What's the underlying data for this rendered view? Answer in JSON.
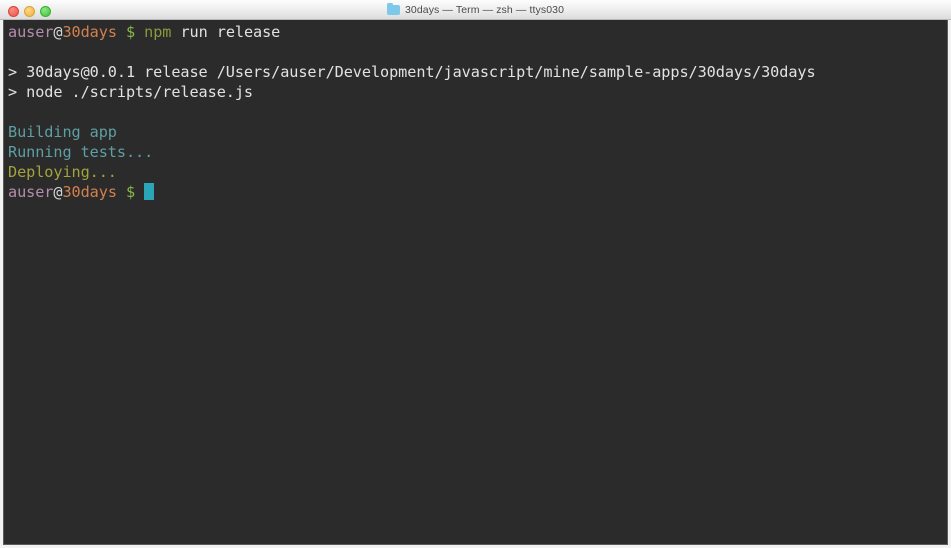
{
  "window": {
    "title": "30days — Term — zsh — ttys030",
    "folder_icon": "folder-icon",
    "controls": {
      "close": "close",
      "minimize": "minimize",
      "maximize": "maximize"
    }
  },
  "colors": {
    "terminal_background": "#2b2b2b",
    "titlebar_background": "#ededed",
    "foreground": "#e2e2e2",
    "user": "#b48ead",
    "host": "#d4804d",
    "dollar": "#86b84b",
    "command": "#8a9a3c",
    "cyan": "#5e9fa3",
    "yellow": "#a3a33c",
    "cursor": "#2ba6b8",
    "folder_icon": "#7ec9ea"
  },
  "terminal": {
    "lines": [
      {
        "id": "prompt-line-1",
        "segments": [
          {
            "text": "auser",
            "style": "c-user"
          },
          {
            "text": "@",
            "style": "c-at"
          },
          {
            "text": "30days",
            "style": "c-host"
          },
          {
            "text": " ",
            "style": "c-plain"
          },
          {
            "text": "$",
            "style": "c-dollar"
          },
          {
            "text": " ",
            "style": "c-plain"
          },
          {
            "text": "npm",
            "style": "c-cmd"
          },
          {
            "text": " run release",
            "style": "c-plain"
          }
        ]
      },
      {
        "id": "blank-1",
        "segments": []
      },
      {
        "id": "npm-header-line",
        "segments": [
          {
            "text": "> 30days@0.0.1 release /Users/auser/Development/javascript/mine/sample-apps/30days/30days",
            "style": "c-plain"
          }
        ]
      },
      {
        "id": "npm-script-line",
        "segments": [
          {
            "text": "> node ./scripts/release.js",
            "style": "c-plain"
          }
        ]
      },
      {
        "id": "blank-2",
        "segments": []
      },
      {
        "id": "output-building",
        "segments": [
          {
            "text": "Building app",
            "style": "c-cyan"
          }
        ]
      },
      {
        "id": "output-running-tests",
        "segments": [
          {
            "text": "Running tests...",
            "style": "c-cyan"
          }
        ]
      },
      {
        "id": "output-deploying",
        "segments": [
          {
            "text": "Deploying...",
            "style": "c-yellow"
          }
        ]
      },
      {
        "id": "prompt-line-2",
        "segments": [
          {
            "text": "auser",
            "style": "c-user"
          },
          {
            "text": "@",
            "style": "c-at"
          },
          {
            "text": "30days",
            "style": "c-host"
          },
          {
            "text": " ",
            "style": "c-plain"
          },
          {
            "text": "$",
            "style": "c-dollar"
          },
          {
            "text": " ",
            "style": "c-plain"
          }
        ],
        "cursor": true
      }
    ]
  }
}
